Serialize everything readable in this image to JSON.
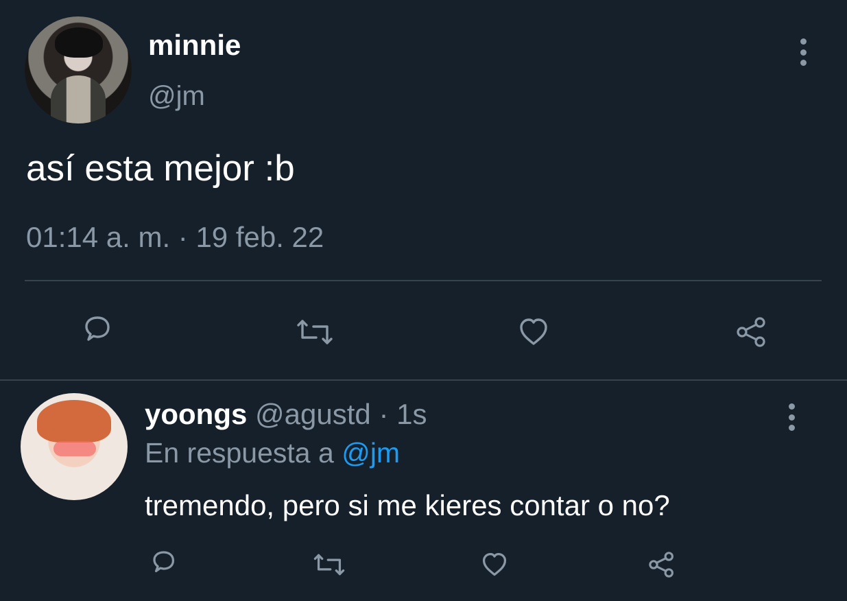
{
  "main_tweet": {
    "author": {
      "display_name": "minnie",
      "handle": "@jm"
    },
    "text": "así esta mejor :b",
    "timestamp": "01:14 a. m. · 19 feb. 22",
    "actions": [
      "reply-icon",
      "retweet-icon",
      "like-icon",
      "share-icon"
    ]
  },
  "reply_tweet": {
    "author": {
      "display_name": "yoongs",
      "handle": "@agustd",
      "time": "· 1s"
    },
    "context": {
      "prefix": "En respuesta a",
      "mention": "@jm"
    },
    "text": "tremendo, pero si me kieres contar o no?",
    "actions": [
      "reply-icon",
      "retweet-icon",
      "like-icon",
      "share-icon"
    ]
  },
  "theme": {
    "background": "#15202b",
    "text_primary": "#ffffff",
    "text_secondary": "#8b98a5",
    "divider": "#38444d",
    "accent": "#1d9bf0"
  }
}
